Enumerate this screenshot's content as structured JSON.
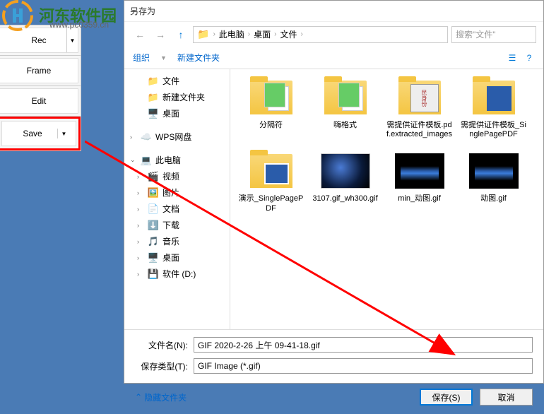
{
  "watermark": {
    "text": "河东软件园",
    "url": "www.pc0359.cn"
  },
  "left_toolbar": {
    "rec": "Rec",
    "frame": "Frame",
    "edit": "Edit",
    "save": "Save"
  },
  "dialog": {
    "title": "另存为",
    "breadcrumb": [
      "此电脑",
      "桌面",
      "文件"
    ],
    "search_placeholder": "搜索\"文件\"",
    "organize": "组织",
    "new_folder": "新建文件夹"
  },
  "tree": [
    {
      "label": "文件",
      "icon": "folder",
      "indent": 1
    },
    {
      "label": "新建文件夹",
      "icon": "folder",
      "indent": 1
    },
    {
      "label": "桌面",
      "icon": "desktop",
      "indent": 1
    },
    {
      "spacer": true
    },
    {
      "label": "WPS网盘",
      "icon": "cloud",
      "indent": 0,
      "expand": "›"
    },
    {
      "spacer": true
    },
    {
      "label": "此电脑",
      "icon": "pc",
      "indent": 0,
      "expand": "⌄"
    },
    {
      "label": "视频",
      "icon": "video",
      "indent": 1,
      "expand": "›"
    },
    {
      "label": "图片",
      "icon": "image",
      "indent": 1,
      "expand": "›"
    },
    {
      "label": "文档",
      "icon": "doc",
      "indent": 1,
      "expand": "›"
    },
    {
      "label": "下载",
      "icon": "download",
      "indent": 1,
      "expand": "›"
    },
    {
      "label": "音乐",
      "icon": "music",
      "indent": 1,
      "expand": "›"
    },
    {
      "label": "桌面",
      "icon": "desktop",
      "indent": 1,
      "expand": "›"
    },
    {
      "label": "软件 (D:)",
      "icon": "disk",
      "indent": 1,
      "expand": "›"
    }
  ],
  "files": [
    {
      "name": "分隔符",
      "type": "folder-docs"
    },
    {
      "name": "嗨格式",
      "type": "folder-docs"
    },
    {
      "name": "需提供证件模板.pdf.extracted_images",
      "type": "folder-img"
    },
    {
      "name": "需提供证件模板_SinglePagePDF",
      "type": "folder-pdf"
    },
    {
      "name": "演示_SinglePagePDF",
      "type": "folder-slides"
    },
    {
      "name": "3107.gif_wh300.gif",
      "type": "gif-earth"
    },
    {
      "name": "min_动图.gif",
      "type": "gif-city"
    },
    {
      "name": "动图.gif",
      "type": "gif-city"
    }
  ],
  "inputs": {
    "filename_label": "文件名(N):",
    "filename_value": "GIF 2020-2-26 上午 09-41-18.gif",
    "filetype_label": "保存类型(T):",
    "filetype_value": "GIF Image (*.gif)"
  },
  "footer": {
    "hide_folders": "隐藏文件夹",
    "save": "保存(S)",
    "cancel": "取消"
  },
  "colors": {
    "highlight_red": "#ff0000",
    "link_blue": "#0066cc",
    "win_blue": "#0078d7"
  }
}
